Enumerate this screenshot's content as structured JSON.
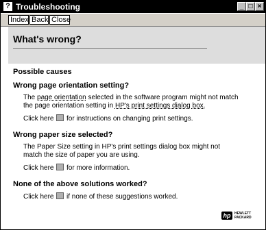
{
  "window": {
    "title": "Troubleshooting",
    "icon_glyph": "?",
    "minimize_glyph": "_",
    "maximize_glyph": "□",
    "close_glyph": "×"
  },
  "toolbar": {
    "index_label": "Index",
    "back_label": "Back",
    "close_label": "Close"
  },
  "header": {
    "title": "What's wrong?"
  },
  "content": {
    "possible_causes": "Possible causes",
    "section1": {
      "heading": "Wrong page orientation setting?",
      "line1_pre": "The ",
      "line1_link": "page orientation",
      "line1_post": " selected in the software program might not match",
      "line2_pre": "the page orientation setting in ",
      "line2_link": "HP's print settings dialog box.",
      "click_pre": "Click here ",
      "click_post": " for instructions on changing print settings."
    },
    "section2": {
      "heading": "Wrong paper size selected?",
      "line1": "The Paper Size setting in HP's print settings dialog box might not",
      "line2": "match the size of paper you are using.",
      "click_pre": "Click here ",
      "click_post": " for more information."
    },
    "section3": {
      "heading": "None of the above solutions worked?",
      "click_pre": "Click here ",
      "click_post": " if none of these suggestions worked."
    }
  },
  "logo": {
    "mark": "hp",
    "line1": "HEWLETT",
    "line2": "PACKARD"
  }
}
